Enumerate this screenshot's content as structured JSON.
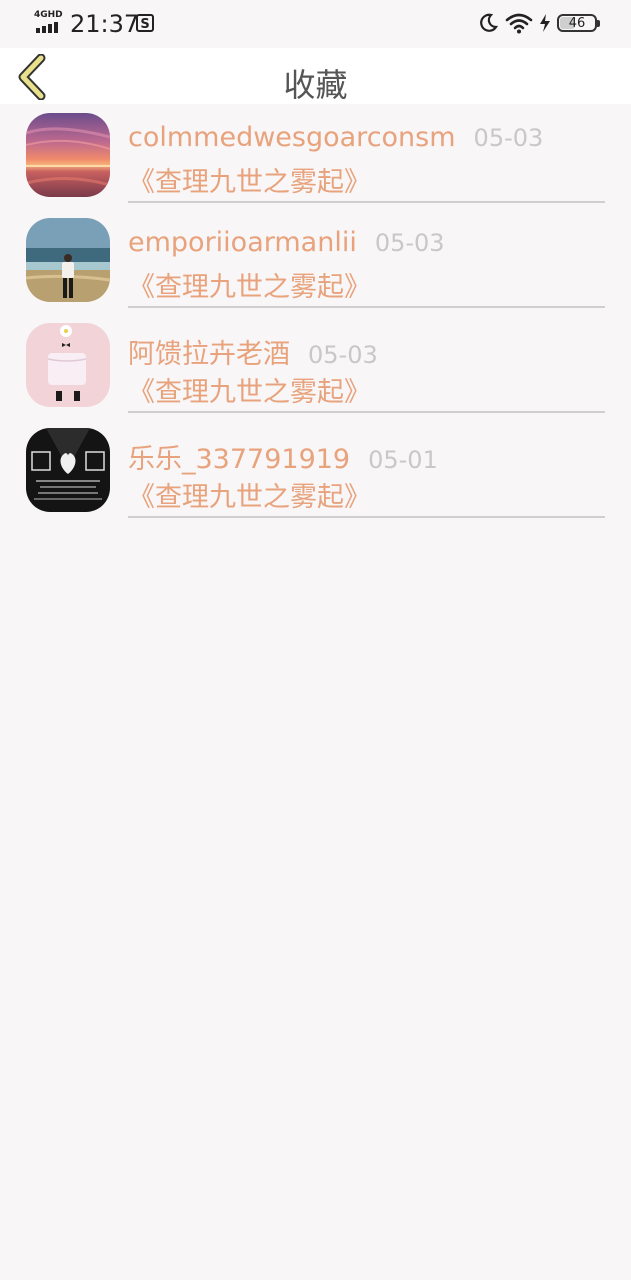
{
  "status_bar": {
    "network": "4GHD",
    "time": "21:37",
    "battery": "46",
    "battery_level": 0.46,
    "icons": [
      "signal-icon",
      "s-app-icon",
      "moon-icon",
      "wifi-icon",
      "charging-icon",
      "battery-icon"
    ]
  },
  "header": {
    "title": "收藏",
    "back_icon": "chevron-left-icon"
  },
  "colors": {
    "accent": "#e8a27c",
    "date": "#c8c8c8",
    "divider": "#cfcfcf",
    "back_arrow": "#e8e08a",
    "background": "#f8f6f7"
  },
  "favorites": [
    {
      "username": "colmmedwesgoarconsm",
      "date": "05-03",
      "book": "《查理九世之雾起》",
      "avatar": "sunset-avatar"
    },
    {
      "username": "emporiioarmanlii",
      "date": "05-03",
      "book": "《查理九世之雾起》",
      "avatar": "beach-person-avatar"
    },
    {
      "username": "阿馈拉卉老酒",
      "date": "05-03",
      "book": "《查理九世之雾起》",
      "avatar": "pink-fashion-avatar"
    },
    {
      "username": "乐乐_337791919",
      "date": "05-01",
      "book": "《查理九世之雾起》",
      "avatar": "cancer-zodiac-avatar"
    }
  ]
}
